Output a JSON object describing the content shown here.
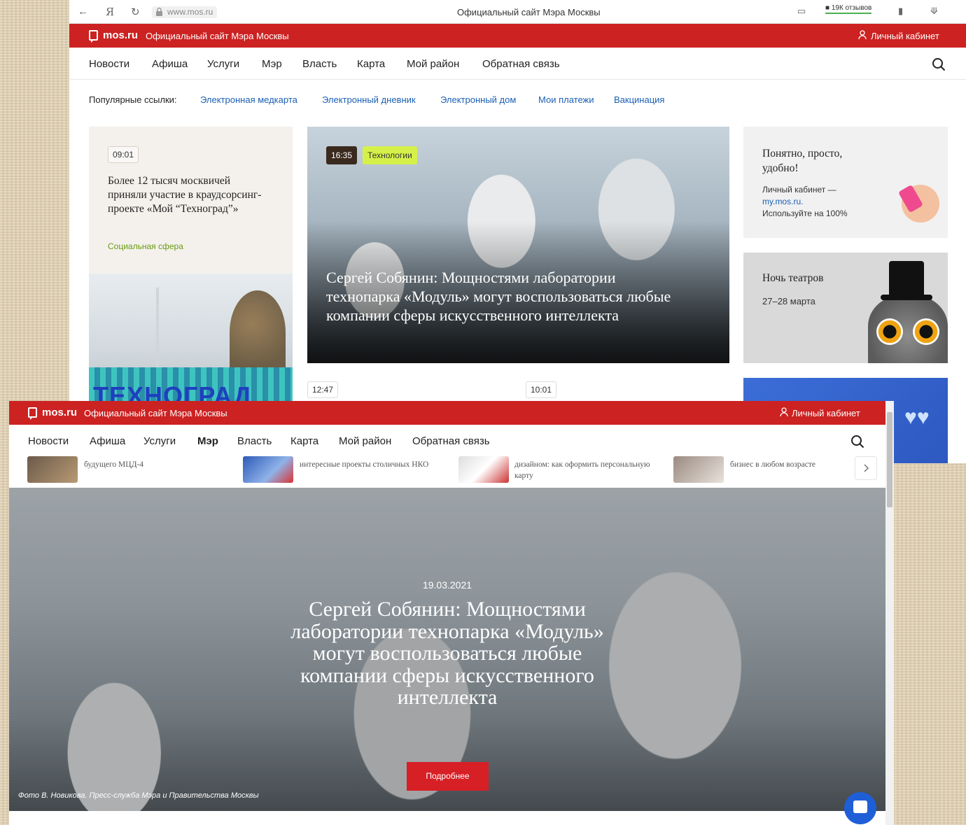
{
  "browser": {
    "url": "www.mos.ru",
    "title": "Официальный сайт Мэра Москвы",
    "reviews": "19К отзывов"
  },
  "header": {
    "brand": "mos.ru",
    "site_title": "Официальный сайт Мэра Москвы",
    "cabinet": "Личный кабинет"
  },
  "nav": {
    "items": [
      "Новости",
      "Афиша",
      "Услуги",
      "Мэр",
      "Власть",
      "Карта",
      "Мой район",
      "Обратная связь"
    ]
  },
  "popular": {
    "label": "Популярные ссылки:",
    "links": [
      "Электронная медкарта",
      "Электронный дневник",
      "Электронный дом",
      "Мои платежи",
      "Вакцинация"
    ]
  },
  "news_left": {
    "time": "09:01",
    "headline": "Более 12 тысяч москвичей приняли участие в краудсорсинг-проекте «Мой “Техноград”»",
    "rubric": "Социальная сфера",
    "image_text": "ТЕХНОГРАД"
  },
  "news_main": {
    "time": "16:35",
    "rubric": "Технологии",
    "headline": "Сергей Собянин: Мощностями лаборатории технопарка «Модуль» могут воспользоваться любые компании сферы искусственного интеллекта"
  },
  "promo_cabinet": {
    "heading": "Понятно, просто, удобно!",
    "text1": "Личный кабинет —",
    "link": "my.mos.ru.",
    "text2": "Используйте на 100%"
  },
  "promo_theatre": {
    "heading": "Ночь театров",
    "dates": "27–28 марта"
  },
  "row_times": [
    "12:47",
    "10:01"
  ],
  "strip": {
    "captions": [
      "будущего МЦД-4",
      "интересные проекты столичных НКО",
      "дизайном: как оформить персональную карту",
      "бизнес в любом возрасте"
    ]
  },
  "hero": {
    "date": "19.03.2021",
    "title": "Сергей Собянин: Мощностями лаборатории технопарка «Модуль» могут воспользоваться любые компании сферы искусственного интеллекта",
    "button": "Подробнее",
    "credit": "Фото В. Новикова. Пресс-служба Мэра и Правительства Москвы"
  },
  "colors": {
    "header_red": "#cc2222",
    "link_blue": "#1a5fb4",
    "rubric_green": "#6a9a13",
    "button_red": "#d71f26",
    "chat_blue": "#1e5fd8"
  }
}
